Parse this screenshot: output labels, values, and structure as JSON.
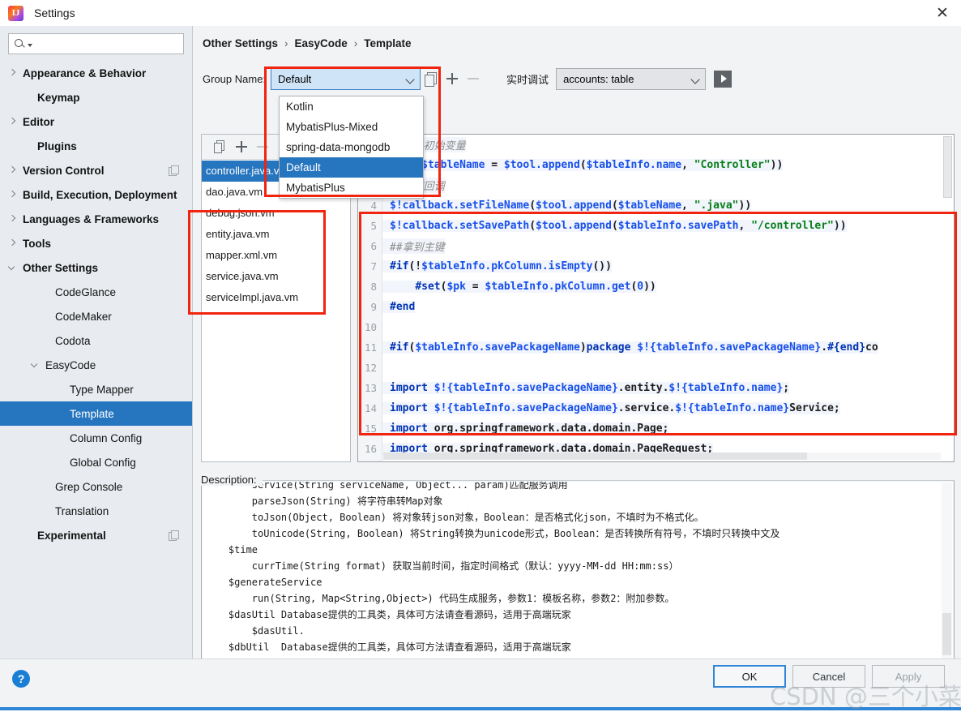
{
  "window": {
    "title": "Settings",
    "logo_text": "IJ",
    "close_icon": "✕"
  },
  "search": {
    "placeholder": "",
    "value": ""
  },
  "sidebar": {
    "items": [
      {
        "label": "Appearance & Behavior",
        "arrow": "right",
        "bold": true,
        "indent": 10,
        "selected": false,
        "copy": false
      },
      {
        "label": "Keymap",
        "arrow": "none",
        "bold": true,
        "indent": 28,
        "selected": false,
        "copy": false
      },
      {
        "label": "Editor",
        "arrow": "right",
        "bold": true,
        "indent": 10,
        "selected": false,
        "copy": false
      },
      {
        "label": "Plugins",
        "arrow": "none",
        "bold": true,
        "indent": 28,
        "selected": false,
        "copy": false
      },
      {
        "label": "Version Control",
        "arrow": "right",
        "bold": true,
        "indent": 10,
        "selected": false,
        "copy": true
      },
      {
        "label": "Build, Execution, Deployment",
        "arrow": "right",
        "bold": true,
        "indent": 10,
        "selected": false,
        "copy": false
      },
      {
        "label": "Languages & Frameworks",
        "arrow": "right",
        "bold": true,
        "indent": 10,
        "selected": false,
        "copy": false
      },
      {
        "label": "Tools",
        "arrow": "right",
        "bold": true,
        "indent": 10,
        "selected": false,
        "copy": false
      },
      {
        "label": "Other Settings",
        "arrow": "down",
        "bold": true,
        "indent": 10,
        "selected": false,
        "copy": false
      },
      {
        "label": "CodeGlance",
        "arrow": "none",
        "bold": false,
        "indent": 50,
        "selected": false,
        "copy": false
      },
      {
        "label": "CodeMaker",
        "arrow": "none",
        "bold": false,
        "indent": 50,
        "selected": false,
        "copy": false
      },
      {
        "label": "Codota",
        "arrow": "none",
        "bold": false,
        "indent": 50,
        "selected": false,
        "copy": false
      },
      {
        "label": "EasyCode",
        "arrow": "down",
        "bold": false,
        "indent": 38,
        "selected": false,
        "copy": false
      },
      {
        "label": "Type Mapper",
        "arrow": "none",
        "bold": false,
        "indent": 68,
        "selected": false,
        "copy": false
      },
      {
        "label": "Template",
        "arrow": "none",
        "bold": false,
        "indent": 68,
        "selected": true,
        "copy": false
      },
      {
        "label": "Column Config",
        "arrow": "none",
        "bold": false,
        "indent": 68,
        "selected": false,
        "copy": false
      },
      {
        "label": "Global Config",
        "arrow": "none",
        "bold": false,
        "indent": 68,
        "selected": false,
        "copy": false
      },
      {
        "label": "Grep Console",
        "arrow": "none",
        "bold": false,
        "indent": 50,
        "selected": false,
        "copy": false
      },
      {
        "label": "Translation",
        "arrow": "none",
        "bold": false,
        "indent": 50,
        "selected": false,
        "copy": false
      },
      {
        "label": "Experimental",
        "arrow": "none",
        "bold": true,
        "indent": 28,
        "selected": false,
        "copy": true
      }
    ]
  },
  "breadcrumb": {
    "parts": [
      "Other Settings",
      "EasyCode",
      "Template"
    ],
    "separator": "›"
  },
  "toolbar": {
    "group_name_label": "Group Name:",
    "group_name_value": "Default",
    "realtime_debug_label": "实时调试",
    "debug_table_value": "accounts: table"
  },
  "group_dropdown": {
    "open": true,
    "options": [
      {
        "label": "Kotlin",
        "selected": false
      },
      {
        "label": "MybatisPlus-Mixed",
        "selected": false
      },
      {
        "label": "spring-data-mongodb",
        "selected": false
      },
      {
        "label": "Default",
        "selected": true
      },
      {
        "label": "MybatisPlus",
        "selected": false
      }
    ]
  },
  "file_list": {
    "items": [
      {
        "name": "controller.java.vm",
        "selected": true
      },
      {
        "name": "dao.java.vm",
        "selected": false
      },
      {
        "name": "debug.json.vm",
        "selected": false
      },
      {
        "name": "entity.java.vm",
        "selected": false
      },
      {
        "name": "mapper.xml.vm",
        "selected": false
      },
      {
        "name": "service.java.vm",
        "selected": false
      },
      {
        "name": "serviceImpl.java.vm",
        "selected": false
      }
    ]
  },
  "code_editor": {
    "lines": [
      {
        "num": "1",
        "text": "##定义初始变量"
      },
      {
        "num": "2",
        "text": "#set($tableName = $tool.append($tableInfo.name, \"Controller\"))"
      },
      {
        "num": "3",
        "text": "##设置回调"
      },
      {
        "num": "4",
        "text": "$!callback.setFileName($tool.append($tableName, \".java\"))"
      },
      {
        "num": "5",
        "text": "$!callback.setSavePath($tool.append($tableInfo.savePath, \"/controller\"))"
      },
      {
        "num": "6",
        "text": "##拿到主键"
      },
      {
        "num": "7",
        "text": "#if(!$tableInfo.pkColumn.isEmpty())"
      },
      {
        "num": "8",
        "text": "    #set($pk = $tableInfo.pkColumn.get(0))"
      },
      {
        "num": "9",
        "text": "#end"
      },
      {
        "num": "10",
        "text": ""
      },
      {
        "num": "11",
        "text": "#if($tableInfo.savePackageName)package $!{tableInfo.savePackageName}.#{end}co"
      },
      {
        "num": "12",
        "text": ""
      },
      {
        "num": "13",
        "text": "import $!{tableInfo.savePackageName}.entity.$!{tableInfo.name};"
      },
      {
        "num": "14",
        "text": "import $!{tableInfo.savePackageName}.service.$!{tableInfo.name}Service;"
      },
      {
        "num": "15",
        "text": "import org.springframework.data.domain.Page;"
      },
      {
        "num": "16",
        "text": "import org.springframework.data.domain.PageRequest;"
      }
    ]
  },
  "description": {
    "label": "Description:",
    "text": "        service(String serviceName, Object... param)匹配服务调用\n        parseJson(String) 将字符串转Map对象\n        toJson(Object, Boolean) 将对象转json对象，Boolean：是否格式化json，不填时为不格式化。\n        toUnicode(String, Boolean) 将String转换为unicode形式，Boolean：是否转换所有符号，不填时只转换中文及\n    $time\n        currTime(String format) 获取当前时间，指定时间格式（默认：yyyy-MM-dd HH:mm:ss）\n    $generateService\n        run(String, Map<String,Object>) 代码生成服务，参数1：模板名称，参数2：附加参数。\n    $dasUtil Database提供的工具类，具体可方法请查看源码，适用于高端玩家\n        $dasUtil.\n    $dbUtil  Database提供的工具类，具体可方法请查看源码，适用于高端玩家"
  },
  "footer": {
    "help_icon": "?",
    "ok_label": "OK",
    "cancel_label": "Cancel",
    "apply_label": "Apply"
  },
  "watermark": {
    "text": "CSDN @三个小菜鸟合体"
  },
  "colors": {
    "accent": "#2675bf",
    "annotation_red": "#f0240f",
    "primary_button_border": "#2f86d6"
  }
}
